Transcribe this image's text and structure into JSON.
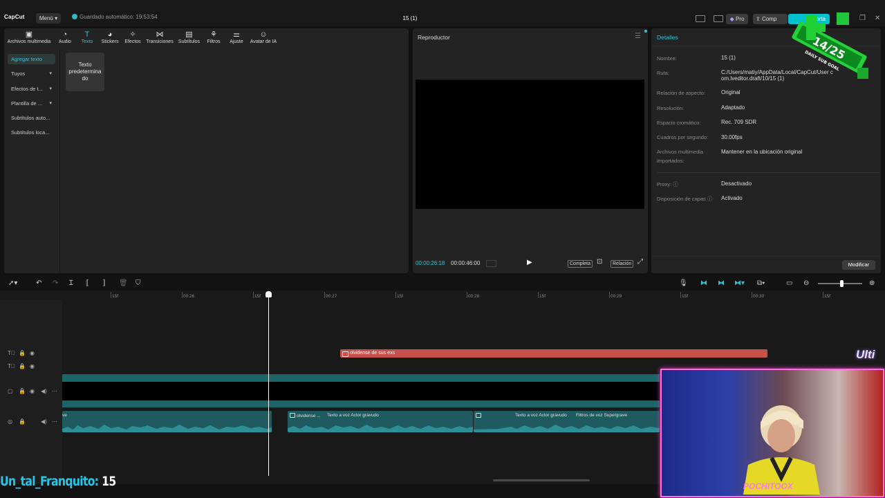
{
  "app": {
    "logo_text": "CapCut",
    "menu_label": "Menú",
    "autosave_text": "Guardado automático: 19:53:54",
    "project_title": "15 (1)",
    "pro_label": "Pro",
    "comp_label": "Comp",
    "export_label": "Exporta"
  },
  "toolbar": {
    "tools": [
      {
        "label": "Archivos multimedia",
        "icon": "media-icon"
      },
      {
        "label": "Audio",
        "icon": "audio-icon"
      },
      {
        "label": "Texto",
        "icon": "text-icon"
      },
      {
        "label": "Stickers",
        "icon": "sticker-icon"
      },
      {
        "label": "Efectos",
        "icon": "effects-icon"
      },
      {
        "label": "Transiciones",
        "icon": "transitions-icon"
      },
      {
        "label": "Subtítulos",
        "icon": "subtitles-icon"
      },
      {
        "label": "Filtros",
        "icon": "filters-icon"
      },
      {
        "label": "Ajuste",
        "icon": "adjust-icon"
      },
      {
        "label": "Avatar de IA",
        "icon": "ai-avatar-icon"
      }
    ],
    "active_tool": "Texto"
  },
  "sidebar": {
    "items": [
      {
        "label": "Agregar texto"
      },
      {
        "label": "Tuyos"
      },
      {
        "label": "Efectos de t..."
      },
      {
        "label": "Plantilla de ..."
      },
      {
        "label": "Subtítulos auto..."
      },
      {
        "label": "Subtítulos loca..."
      }
    ]
  },
  "text_card": {
    "label": "Texto predetermina do"
  },
  "player": {
    "title": "Reproductor",
    "current_time": "00:00:26:18",
    "total_time": "00:00:46:00",
    "full_label": "Completa",
    "ratio_label": "Relación"
  },
  "details": {
    "title": "Detalles",
    "rows": [
      {
        "label": "Nombre:",
        "value": "15 (1)"
      },
      {
        "label": "Ruta:",
        "value": "C:/Users/matiy/AppData/Local/CapCut/User com.lveditor.draft/10/15 (1)"
      },
      {
        "label": "Relación de aspecto:",
        "value": "Original"
      },
      {
        "label": "Resolución:",
        "value": "Adaptado"
      },
      {
        "label": "Espacio cromático:",
        "value": "Rec. 709 SDR"
      },
      {
        "label": "Cuadros por segundo:",
        "value": "30.00fps"
      },
      {
        "label": "Archivos multimedia importados:",
        "value": "Mantener en la ubicación original"
      },
      {
        "label": "Proxy:",
        "value": "Desactivado"
      },
      {
        "label": "Disposición de capas",
        "value": "Activado"
      }
    ],
    "modify_label": "Modificar"
  },
  "ruler": {
    "labels": [
      "15f",
      "00:26",
      "15f",
      "00:27",
      "15f",
      "00:28",
      "15f",
      "00:29",
      "15f",
      "00:30",
      "15f"
    ]
  },
  "timeline": {
    "text_clip": "olvidense de sus exs",
    "audio_clips": [
      {
        "label": "ve"
      },
      {
        "label": "olvidense ..."
      },
      {
        "label": "Texto a voz Actor gravudo"
      },
      {
        "label": "Texto a voz Actor gravudo"
      },
      {
        "label": "Filtros de voz Supergrave"
      }
    ]
  },
  "overlay": {
    "goal_count": "14/25",
    "goal_caption": "DAILY SUB GOAL",
    "ulti_text": "Ulti",
    "webcam_label": "POCHITOOX",
    "chat_user": "Un_tal_Franquito:",
    "chat_value": "15"
  },
  "colors": {
    "accent": "#31c5d4",
    "text_clip": "#c6504b",
    "audio_clip": "#1e5a5f"
  }
}
